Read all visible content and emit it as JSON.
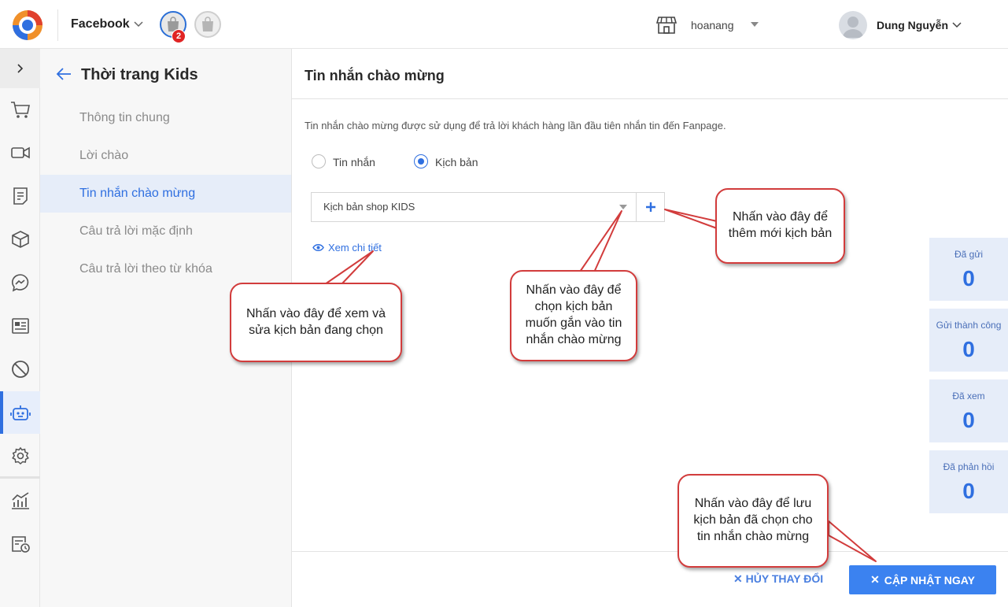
{
  "header": {
    "platform": "Facebook",
    "notification_count": "2",
    "shop_name": "hoanang",
    "user_name": "Dung Nguyễn"
  },
  "rail": {
    "icons": [
      "chevron-right-icon",
      "cart-icon",
      "video-icon",
      "document-icon",
      "box-icon",
      "messenger-icon",
      "contact-card-icon",
      "ban-icon",
      "bot-icon",
      "gear-icon",
      "chart-icon",
      "schedule-icon"
    ]
  },
  "menu": {
    "title": "Thời trang Kids",
    "items": [
      {
        "label": "Thông tin chung"
      },
      {
        "label": "Lời chào"
      },
      {
        "label": "Tin nhắn chào mừng"
      },
      {
        "label": "Câu trả lời mặc định"
      },
      {
        "label": "Câu trả lời theo từ khóa"
      }
    ]
  },
  "main": {
    "title": "Tin nhắn chào mừng",
    "description": "Tin nhắn chào mừng được sử dụng để trả lời khách hàng lần đầu tiên nhắn tin đến Fanpage.",
    "radio_message": "Tin nhắn",
    "radio_script": "Kịch bản",
    "selected_script": "Kịch bản shop KIDS",
    "detail_link": "Xem chi tiết",
    "cancel_label": "HỦY THAY ĐỔI",
    "save_label": "CẬP NHẬT NGAY"
  },
  "stats": [
    {
      "label": "Đã gửi",
      "value": "0"
    },
    {
      "label": "Gửi thành công",
      "value": "0"
    },
    {
      "label": "Đã xem",
      "value": "0"
    },
    {
      "label": "Đã phản hồi",
      "value": "0"
    }
  ],
  "callouts": {
    "add_script": "Nhấn vào đây để thêm mới kịch bản",
    "choose_script": "Nhấn vào đây để chọn kịch bản muốn gắn vào tin nhắn chào mừng",
    "view_script": "Nhấn vào đây để xem và sửa kịch bản đang chọn",
    "save_script": "Nhấn vào đây để lưu kịch bản đã chọn cho tin nhắn chào mừng"
  },
  "colors": {
    "accent": "#2f6fe0",
    "callout_border": "#d23c3c",
    "badge": "#e02424"
  }
}
